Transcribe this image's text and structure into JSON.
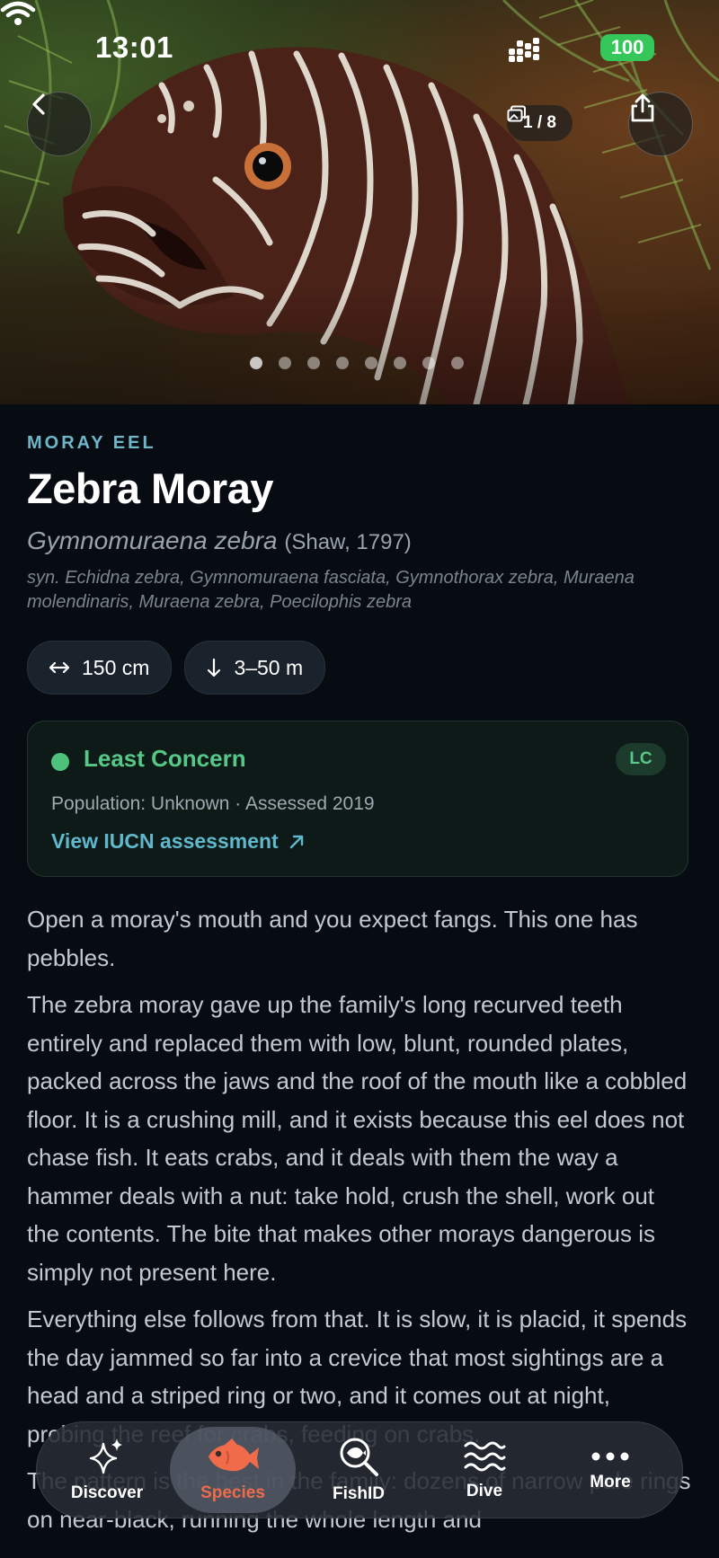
{
  "status_bar": {
    "time": "13:01",
    "battery": "100"
  },
  "gallery": {
    "counter": "1 / 8",
    "total_images": 8,
    "current_image": 1
  },
  "species": {
    "family": "MORAY EEL",
    "common_name": "Zebra Moray",
    "scientific_name": "Gymnomuraena zebra",
    "authority": "(Shaw, 1797)",
    "synonyms": "syn. Echidna zebra, Gymnomuraena fasciata, Gymnothorax zebra, Muraena molendinaris, Muraena zebra, Poecilophis zebra"
  },
  "chips": {
    "length": "150 cm",
    "depth": "3–50 m"
  },
  "conservation": {
    "status": "Least Concern",
    "code": "LC",
    "meta": "Population: Unknown · Assessed 2019",
    "link": "View IUCN assessment",
    "color": "#4cc27a"
  },
  "article": {
    "p1": "Open a moray's mouth and you expect fangs. This one has pebbles.",
    "p2": "The zebra moray gave up the family's long recurved teeth entirely and replaced them with low, blunt, rounded plates, packed across the jaws and the roof of the mouth like a cobbled floor. It is a crushing mill, and it exists because this eel does not chase fish. It eats crabs, and it deals with them the way a hammer deals with a nut: take hold, crush the shell, work out the contents. The bite that makes other morays dangerous is simply not present here.",
    "p3": "Everything else follows from that. It is slow, it is placid, it spends the day jammed so far into a crevice that most sightings are a head and a striped ring or two, and it comes out at night, probing the reef for crabs, feeding on crabs.",
    "p4": "The pattern is the best in the family: dozens of narrow pale rings on near-black, running the whole length and"
  },
  "nav": {
    "items": [
      {
        "label": "Discover",
        "icon": "sparkles-icon"
      },
      {
        "label": "Species",
        "icon": "fish-icon"
      },
      {
        "label": "FishID",
        "icon": "fish-search-icon"
      },
      {
        "label": "Dive",
        "icon": "waves-icon"
      },
      {
        "label": "More",
        "icon": "more-dots-icon"
      }
    ],
    "active": "Species",
    "accent": "#ef6b4a"
  }
}
